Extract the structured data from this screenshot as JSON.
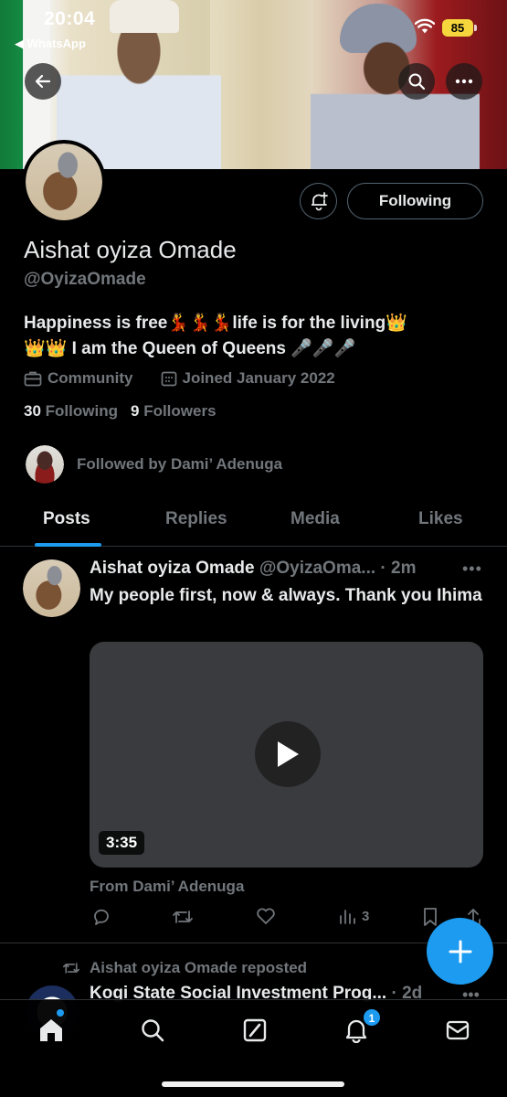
{
  "status_bar": {
    "time": "20:04",
    "back_app": "◀ WhatsApp",
    "battery": "85"
  },
  "profile": {
    "name": "Aishat oyiza Omade",
    "handle": "@OyizaOmade",
    "bio_line1": "Happiness is free💃💃💃life is for the living👑",
    "bio_line2": "👑👑 I am the Queen of Queens 🎤🎤🎤",
    "category": "Community",
    "joined": "Joined January 2022",
    "following_count": "30",
    "following_label": "Following",
    "followers_count": "9",
    "followers_label": "Followers",
    "followed_by": "Followed by Dami’ Adenuga",
    "follow_button": "Following"
  },
  "tabs": [
    "Posts",
    "Replies",
    "Media",
    "Likes"
  ],
  "active_tab": "Posts",
  "tweet": {
    "author": "Aishat oyiza Omade",
    "handle_time": "@OyizaOma... · 2m",
    "text": "My people first, now & always. Thank you Ihima",
    "video_duration": "3:35",
    "from": "From Dami’ Adenuga",
    "views": "3"
  },
  "tweet2": {
    "repost_label": "Aishat oyiza Omade reposted",
    "author": "Kogi State Social Investment Prog...",
    "time": "· 2d"
  },
  "nav": {
    "notifications_badge": "1",
    "icons": [
      "home-icon",
      "search-icon",
      "grok-icon",
      "notifications-icon",
      "messages-icon"
    ]
  },
  "colors": {
    "accent": "#1d9bf0",
    "background": "#000000",
    "muted": "#71767b",
    "text": "#e7e9ea"
  }
}
